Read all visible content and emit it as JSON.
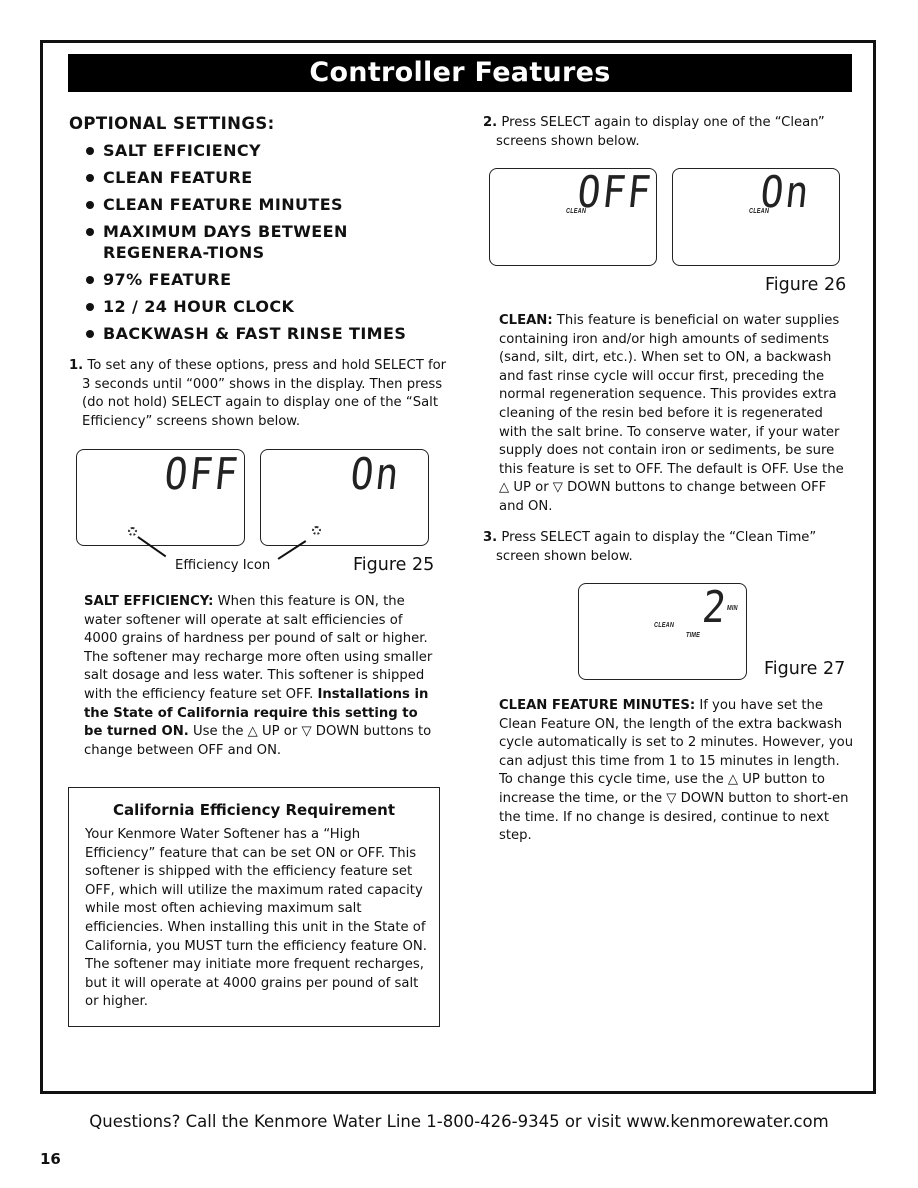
{
  "header": {
    "title": "Controller Features"
  },
  "optional_settings": {
    "heading": "OPTIONAL SETTINGS:",
    "items": [
      "SALT EFFICIENCY",
      "CLEAN FEATURE",
      "CLEAN FEATURE MINUTES",
      "MAXIMUM DAYS BETWEEN REGENERA-TIONS",
      "97% FEATURE",
      "12 / 24 HOUR CLOCK",
      "BACKWASH & FAST RINSE TIMES"
    ]
  },
  "step1": {
    "number": "1.",
    "text": "To set any of these options, press and hold SELECT for 3 seconds until “000” shows in the display.  Then press (do not hold) SELECT again to display one of the “Salt Efficiency” screens shown below."
  },
  "figure25": {
    "label": "Figure 25",
    "screens": [
      {
        "display": "OFF",
        "icon": "efficiency-icon"
      },
      {
        "display": "On",
        "icon": "efficiency-icon"
      }
    ],
    "callout": "Efficiency Icon"
  },
  "salt_efficiency": {
    "term": "SALT EFFICIENCY:",
    "text1": " When this feature is ON, the water softener will operate at salt efficiencies of 4000 grains of hardness per pound of salt or higher. The softener may recharge more often using smaller salt dosage and less water.  This softener is shipped with the efficiency feature set OFF.  ",
    "bold": "Installations in the State of California require this setting to be turned ON.",
    "text2": "  Use the △ UP or ▽ DOWN buttons to change between OFF and ON."
  },
  "california_box": {
    "title": "California Efficiency Requirement",
    "text": "Your Kenmore Water Softener has a “High Efficiency” feature that can be set ON or OFF. This softener is shipped with the efficiency feature set OFF, which will utilize the maximum rated capacity while most often achieving maximum salt efficiencies.  When installing this unit in the State of California, you MUST turn the efficiency feature ON.  The softener may initiate more frequent recharges, but it will operate at 4000 grains per pound of salt or higher."
  },
  "step2": {
    "number": "2.",
    "text": "Press SELECT again to display one of the “Clean” screens shown below."
  },
  "figure26": {
    "label": "Figure 26",
    "screens": [
      {
        "display": "OFF",
        "tag": "CLEAN"
      },
      {
        "display": "On",
        "tag": "CLEAN"
      }
    ]
  },
  "clean": {
    "term": "CLEAN:",
    "text": " This feature is beneficial on water supplies containing iron and/or high amounts of sediments (sand, silt, dirt, etc.).  When set to ON, a backwash and fast rinse cycle will occur first, preceding the normal regeneration sequence.  This provides extra cleaning of the resin bed before it is regenerated with the salt brine.  To conserve water, if your water supply does not contain iron or sediments, be sure this feature is set to OFF.  The default is OFF.  Use the △ UP or ▽ DOWN buttons to change between OFF and ON."
  },
  "step3": {
    "number": "3.",
    "text": "Press SELECT again to display the “Clean Time” screen shown below."
  },
  "figure27": {
    "label": "Figure 27",
    "display": "2",
    "unit": "MIN",
    "tag1": "CLEAN",
    "tag2": "TIME"
  },
  "clean_minutes": {
    "term": "CLEAN FEATURE MINUTES:",
    "text": " If you have set the Clean Feature ON, the length of the extra backwash cycle automatically is set to 2 minutes.  However, you can adjust this time from 1 to 15 minutes in length. To change this cycle time, use the △ UP button to increase the time, or the ▽ DOWN button to short-en the time.  If no change is desired, continue to next step."
  },
  "footer": {
    "text": "Questions? Call the Kenmore Water Line 1-800-426-9345 or visit www.kenmorewater.com",
    "page_number": "16"
  }
}
